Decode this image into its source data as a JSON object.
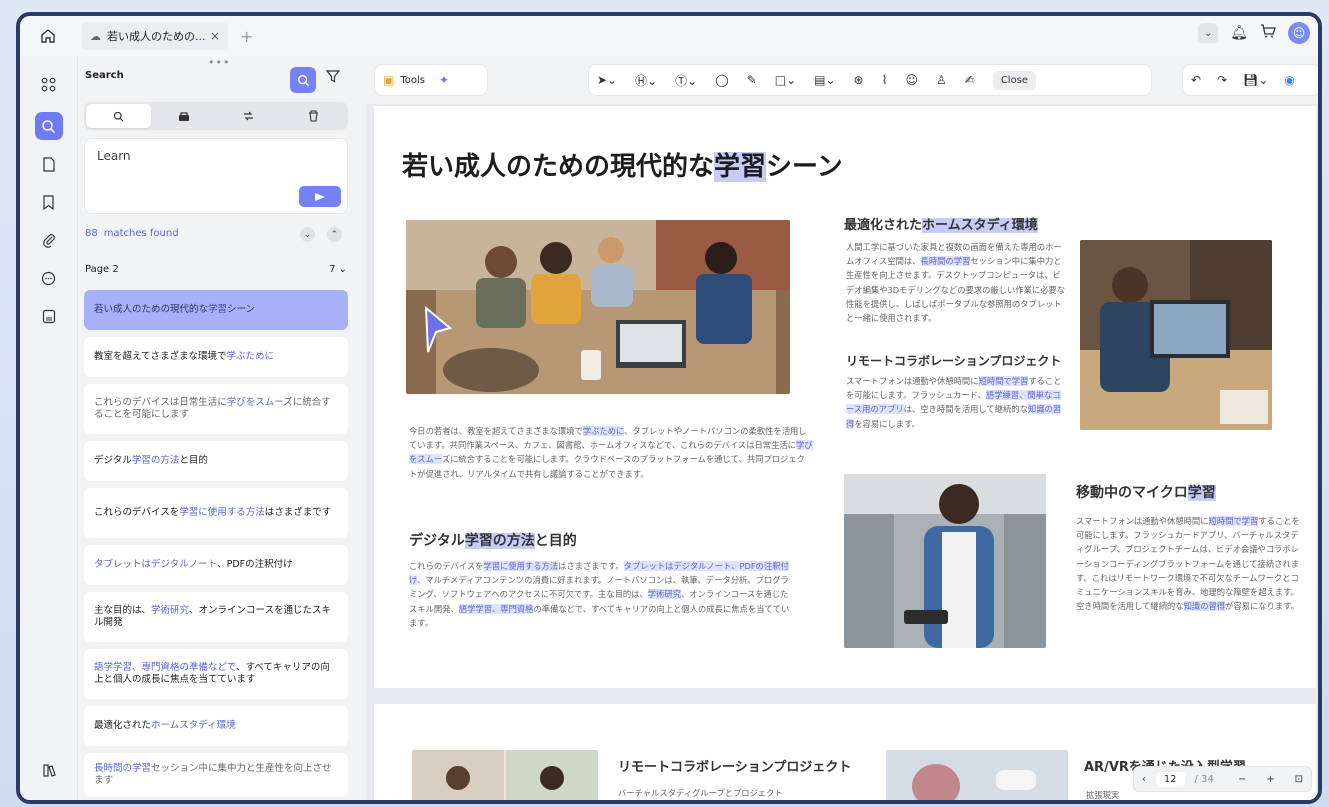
{
  "tab": {
    "title": "若い成人のための...",
    "close": "×",
    "new_tab": "+"
  },
  "panel": {
    "heading": "Search",
    "query": "Learn",
    "matches_count": "88",
    "matches_label": "matches found",
    "page_label": "Page 2",
    "page_count": "7"
  },
  "results": [
    {
      "pre": "若い成人のための現代的な",
      "hl": "学習",
      "post": "シーン"
    },
    {
      "pre": "教室を超えてさまざまな環境で",
      "hl": "学ぶために",
      "post": ""
    },
    {
      "pre": "これらのデバイスは日常生活に",
      "hl": "学びをスムー",
      "post": "ズに統合することを可能にします"
    },
    {
      "pre": "デジタル",
      "hl": "学習の方法",
      "post": "と目的"
    },
    {
      "pre": "これらのデバイスを",
      "hl": "学習に使用する方法",
      "post": "はさまざまです"
    },
    {
      "pre": "",
      "hl": "タブレットはデジタルノート",
      "post": "、PDFの注釈付け"
    },
    {
      "pre": "主な目的は、",
      "hl": "学術研究",
      "post": "、オンラインコースを通じたスキル開発"
    },
    {
      "pre": "",
      "hl": "語学学習、専門資格の準備などで",
      "post": "、すべてキャリアの向上と個人の成長に焦点を当てています"
    },
    {
      "pre": "最適化された",
      "hl": "ホームスタディ環境",
      "post": ""
    },
    {
      "pre": "",
      "hl": "長時間の学習",
      "post": "セッション中に集中力と生産性を向上させます"
    }
  ],
  "toolbar": {
    "tools_label": "Tools",
    "close_label": "Close"
  },
  "doc": {
    "title_pre": "若い成人のための現代的な",
    "title_hl": "学習",
    "title_post": "シーン",
    "intro_1": "今日の若者は、教室を超えてさまざまな環境で",
    "intro_hl1": "学ぶために",
    "intro_2": "、タブレットやノートパソコンの柔軟性を活用しています。共同作業スペース、カフェ、図書館、ホームオフィスなどで、これらのデバイスは日常生活に",
    "intro_hl2": "学びをスムー",
    "intro_3": "ズに統合することを可能にします。クラウドベースのプラットフォームを通じて、共同プロジェクトが促進され、リアルタイムで共有し議論することができます。",
    "h_digital_pre": "デジタル",
    "h_digital_hl": "学習の方法",
    "h_digital_post": "と目的",
    "digital_1": "これらのデバイスを",
    "digital_hl1": "学習に使用する方法",
    "digital_2": "はさまざまです。",
    "digital_hl2": "タブレットはデジタルノート、PDFの注釈付け",
    "digital_3": "、マルチメディアコンテンツの消費に好まれます。ノートパソコンは、執筆、データ分析、プログラミング、ソフトウェアへのアクセスに不可欠です。主な目的は、",
    "digital_hl3": "学術研究",
    "digital_4": "、オンラインコースを通じたスキル開発、",
    "digital_hl4": "語学学習、専門資格",
    "digital_5": "の準備などで、すべてキャリアの向上と個人の成長に焦点を当てています。",
    "h_home_pre": "最適化された",
    "h_home_hl": "ホームスタディ環境",
    "home_1": "人間工学に基づいた家具と複数の画面を備えた専用のホームオフィス空間は、",
    "home_hl1": "長時間の学習",
    "home_2": "セッション中に集中力と生産性を向上させます。デスクトップコンピュータは、ビデオ編集や3Dモデリングなどの要求の厳しい作業に必要な性能を提供し、しばしばポータブルな参照用のタブレットと一緒に使用されます。",
    "h_remote": "リモートコラボレーションプロジェクト",
    "remote_1": "スマートフォンは通勤や休憩時間に",
    "remote_hl1": "短時間で学習",
    "remote_2": "することを可能にします。フラッシュカード、",
    "remote_hl2": "語学練習、簡単なコース用のアプリ",
    "remote_3": "は、空き時間を活用して継続的な",
    "remote_hl3": "知識の習得",
    "remote_4": "を容易にします。",
    "h_micro_pre": "移動中のマイクロ",
    "h_micro_hl": "学習",
    "micro_1": "スマートフォンは通勤や休憩時間に",
    "micro_hl1": "短時間で学習",
    "micro_2": "することを可能にします。フラッシュカードアプリ、バーチャルスタディグループ、プロジェクトチームは、ビデオ会議やコラボレーションコーディングプラットフォームを通じて接続されます。これはリモートワーク環境で不可欠なチームワークとコミュニケーションスキルを育み、地理的な障壁を超えます。空き時間を活用して継続的な",
    "micro_hl2": "知識の習得",
    "micro_3": "が容易になります。",
    "p2_h_remote": "リモートコラボレーションプロジェクト",
    "p2_remote_sub": "バーチャルスタディグループとプロジェクト",
    "p2_h_arvr": "AR/VRを通じた没入型学習",
    "p2_arvr_sub": "拡張現実"
  },
  "pager": {
    "current": "12",
    "total": "/ 34"
  },
  "colors": {
    "accent": "#7482f5",
    "highlight": "#c6cbf7",
    "window_border": "#2b3a67"
  }
}
